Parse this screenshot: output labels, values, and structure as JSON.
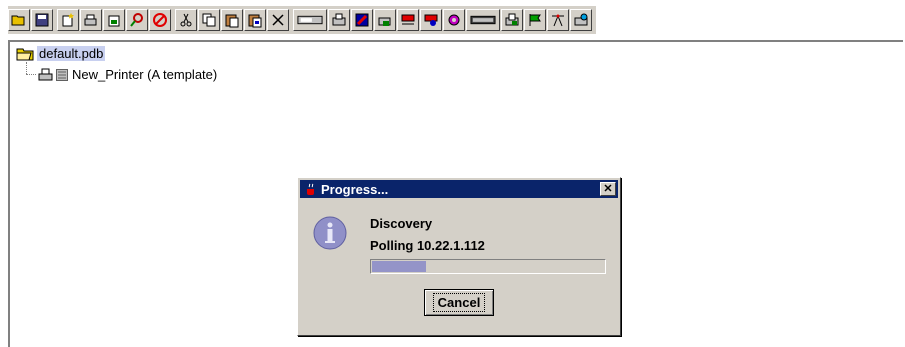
{
  "toolbar": {
    "buttons": [
      {
        "name": "open-folder-icon"
      },
      {
        "name": "save-icon"
      },
      {
        "name": "new-document-icon"
      },
      {
        "name": "new-printer-icon"
      },
      {
        "name": "new-queue-icon"
      },
      {
        "name": "find-icon"
      },
      {
        "name": "stop-icon"
      },
      {
        "name": "cut-icon"
      },
      {
        "name": "copy-icon"
      },
      {
        "name": "paste-icon"
      },
      {
        "name": "paste-special-icon"
      },
      {
        "name": "delete-icon"
      },
      {
        "name": "device-icon"
      },
      {
        "name": "printer-config-icon"
      },
      {
        "name": "printer-color-icon"
      },
      {
        "name": "printer-add-icon"
      },
      {
        "name": "network-red-icon"
      },
      {
        "name": "network-search-icon"
      },
      {
        "name": "settings-icon"
      },
      {
        "name": "panel-icon"
      },
      {
        "name": "printer-list-icon"
      },
      {
        "name": "flag-icon"
      },
      {
        "name": "antenna-icon"
      },
      {
        "name": "printer-web-icon"
      }
    ]
  },
  "tree": {
    "root_label": "default.pdb",
    "child_label": "New_Printer (A template)"
  },
  "dialog": {
    "title": "Progress...",
    "close_glyph": "✕",
    "message_title": "Discovery",
    "message_status": "Polling 10.22.1.112",
    "progress_fraction": 0.23,
    "cancel_label": "Cancel"
  },
  "colors": {
    "title_bar": "#0a246a",
    "progress_fill": "#9494c8",
    "selection": "#c8d0f0"
  }
}
